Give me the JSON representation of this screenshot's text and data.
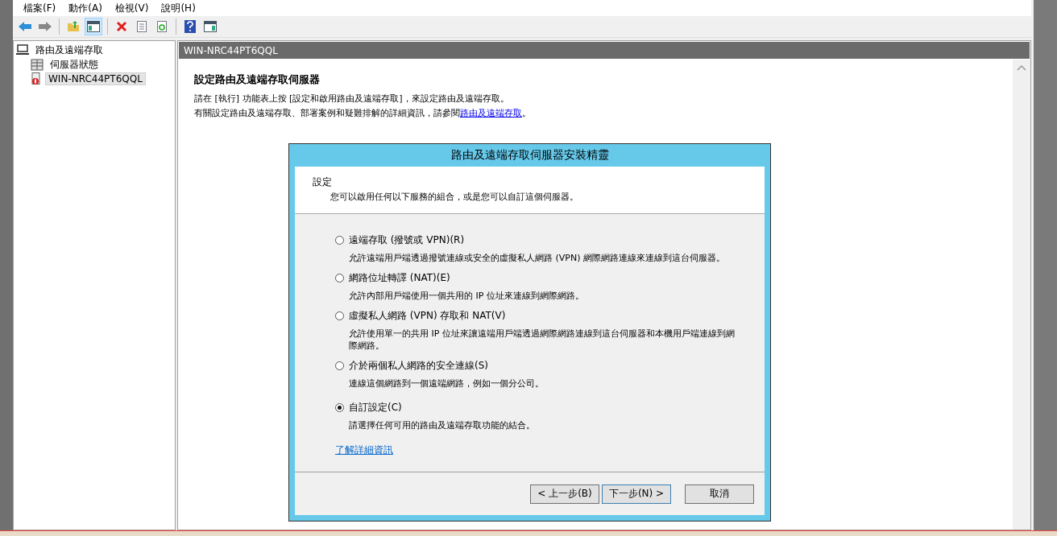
{
  "menu": [
    "檔案(F)",
    "動作(A)",
    "檢視(V)",
    "說明(H)"
  ],
  "toolbar": [
    {
      "kind": "back"
    },
    {
      "kind": "forward"
    },
    {
      "kind": "sep"
    },
    {
      "kind": "up"
    },
    {
      "kind": "tree",
      "pressed": true
    },
    {
      "kind": "sep"
    },
    {
      "kind": "delete"
    },
    {
      "kind": "properties"
    },
    {
      "kind": "refresh"
    },
    {
      "kind": "sep"
    },
    {
      "kind": "help"
    },
    {
      "kind": "action-pane"
    }
  ],
  "tree": {
    "label": "路由及遠端存取",
    "kind": "root",
    "selected": false,
    "children": [
      {
        "label": "伺服器狀態",
        "kind": "status",
        "selected": false
      },
      {
        "label": "WIN-NRC44PT6QQL",
        "kind": "server",
        "selected": true
      }
    ]
  },
  "pane": {
    "header": "WIN-NRC44PT6QQL",
    "heading": "設定路由及遠端存取伺服器",
    "line_1": "請在 [執行] 功能表上按 [設定和啟用路由及遠端存取]，來設定路由及遠端存取。",
    "line_2_before": "有關設定路由及遠端存取、部署案例和疑難排解的詳細資訊，請參閱",
    "line_2_link": "路由及遠端存取",
    "line_2_after": "。"
  },
  "wizard": {
    "title": "路由及遠端存取伺服器安裝精靈",
    "section": "設定",
    "subtitle": "您可以啟用任何以下服務的組合，或是您可以自訂這個伺服器。",
    "options": [
      {
        "label": "遠端存取 (撥號或 VPN)(R)",
        "description": "允許遠端用戶端透過撥號連線或安全的虛擬私人網路 (VPN) 網際網路連線來連線到這台伺服器。",
        "selected": false
      },
      {
        "label": "網路位址轉譯 (NAT)(E)",
        "description": "允許內部用戶端使用一個共用的 IP 位址來連線到網際網路。",
        "selected": false
      },
      {
        "label": "虛擬私人網路 (VPN) 存取和 NAT(V)",
        "description": "允許使用單一的共用 IP 位址來讓遠端用戶端透過網際網路連線到這台伺服器和本機用戶端連線到網際網路。",
        "selected": false
      },
      {
        "label": "介於兩個私人網路的安全連線(S)",
        "description": "連線這個網路到一個遠端網路，例如一個分公司。",
        "selected": false
      },
      {
        "label": "自訂設定(C)",
        "description": "請選擇任何可用的路由及遠端存取功能的結合。",
        "selected": true
      }
    ],
    "learn_more": "了解詳細資訊",
    "buttons": [
      {
        "label": "< 上一步(B)",
        "focused": false
      },
      {
        "label": "下一步(N) >",
        "focused": true
      },
      {
        "label": "取消",
        "focused": false
      }
    ]
  }
}
